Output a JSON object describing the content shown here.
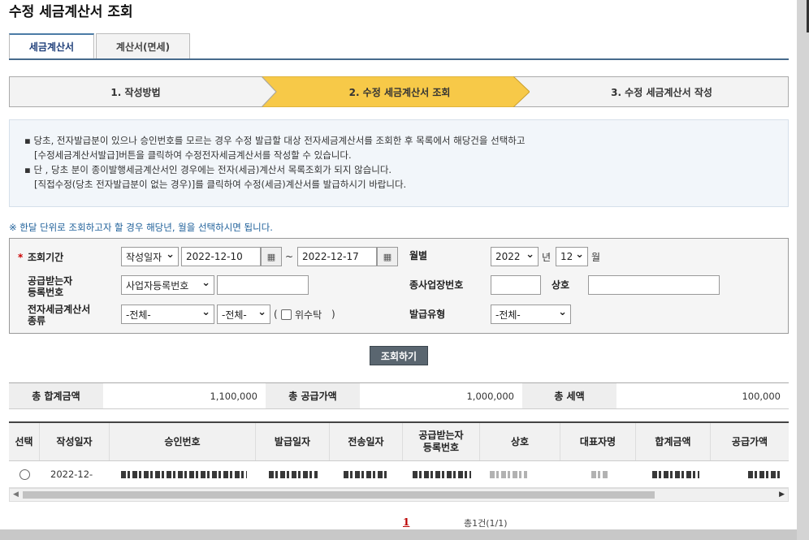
{
  "page_title": "수정 세금계산서 조회",
  "tabs": [
    {
      "label": "세금계산서",
      "active": true
    },
    {
      "label": "계산서(면세)",
      "active": false
    }
  ],
  "steps": [
    {
      "label": "1. 작성방법",
      "active": false
    },
    {
      "label": "2. 수정 세금계산서 조회",
      "active": true
    },
    {
      "label": "3. 수정 세금계산서 작성",
      "active": false
    }
  ],
  "info": {
    "line1": "▪ 당초, 전자발급분이 있으나 승인번호를 모르는 경우 수정 발급할 대상 전자세금계산서를 조회한 후 목록에서 해당건을 선택하고",
    "line2": "[수정세금계산서발급]버튼을 클릭하여 수정전자세금계산서를 작성할 수 있습니다.",
    "line3": "▪ 단 , 당초 분이 종이발행세금계산서인 경우에는 전자(세금)계산서 목록조회가 되지 않습니다.",
    "line4": "[직접수정(당초 전자발급분이 없는 경우)]를 클릭하여 수정(세금)계산서를 발급하시기 바랍니다."
  },
  "hint": "※ 한달 단위로 조회하고자 할 경우 해당년, 월을 선택하시면 됩니다.",
  "form": {
    "required_mark": "*",
    "period_label": "조회기간",
    "date_type": "작성일자",
    "date_from": "2022-12-10",
    "tilde": "~",
    "date_to": "2022-12-17",
    "month_label": "월별",
    "year": "2022",
    "year_unit": "년",
    "month": "12",
    "month_unit": "월",
    "buyer_label_1": "공급받는자",
    "buyer_label_2": "등록번호",
    "buyer_type": "사업자등록번호",
    "buyer_value": "",
    "branch_label": "종사업장번호",
    "branch_value": "",
    "company_label": "상호",
    "company_value": "",
    "kind_label_1": "전자세금계산서",
    "kind_label_2": "종류",
    "kind_1": "-전체-",
    "kind_2": "-전체-",
    "paren_open": "(",
    "trust_label": "위수탁",
    "paren_close": ")",
    "issue_type_label": "발급유형",
    "issue_type": "-전체-"
  },
  "search_button": "조회하기",
  "totals": {
    "total_label": "총 합계금액",
    "total_value": "1,100,000",
    "supply_label": "총 공급가액",
    "supply_value": "1,000,000",
    "tax_label": "총 세액",
    "tax_value": "100,000"
  },
  "grid": {
    "headers": [
      "선택",
      "작성일자",
      "승인번호",
      "발급일자",
      "전송일자",
      "공급받는자\n등록번호",
      "상호",
      "대표자명",
      "합계금액",
      "공급가액"
    ],
    "row": {
      "date": "2022-12-"
    }
  },
  "pager": {
    "current": "1",
    "count": "총1건(1/1)"
  },
  "colors": {
    "accent": "#466a8c",
    "step_active": "#f7c948",
    "button": "#5a6670",
    "required": "#cc0000"
  },
  "icons": [
    "calendar-icon",
    "chevron-down-icon",
    "scroll-left-icon",
    "scroll-right-icon"
  ]
}
